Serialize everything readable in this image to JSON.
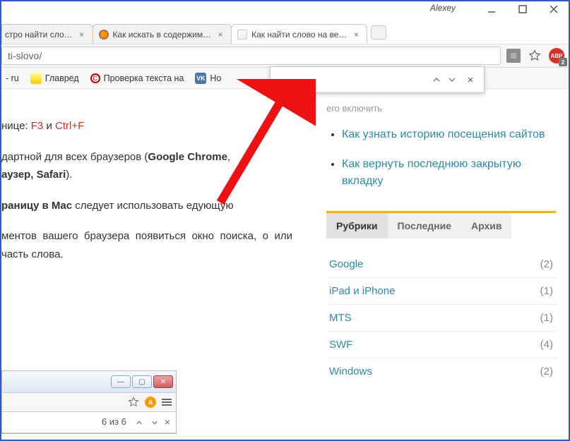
{
  "window": {
    "user_label": "Alexey"
  },
  "tabs": {
    "t0": {
      "title": "стро найти сло…"
    },
    "t1": {
      "title": "Как искать в содержим…"
    },
    "t2": {
      "title": "Как найти слово на ве…"
    }
  },
  "address": {
    "url_fragment": "ti-slovo/"
  },
  "abp": {
    "label": "ABP",
    "badge": "2"
  },
  "bookmarks": {
    "b0": "- ru",
    "b1": "Главред",
    "b2": "Проверка текста на",
    "b3": "Но"
  },
  "article": {
    "line1_a": "нице: ",
    "line1_b": "F3",
    "line1_c": " и ",
    "line1_d": "Ctrl+F",
    "p2_a": "дартной для всех браузеров (",
    "p2_b": "Google Chrome",
    "p2_c": "аузер, Safari",
    "p2_d": ").",
    "p3_a": "раницу в Mac",
    "p3_b": " следует использовать    едующую",
    "p4": "ментов вашего браузера появиться окно поиска, о или часть слова."
  },
  "sidebar_links": {
    "l0_a": "его включить",
    "l1": "Как узнать историю посещения сайтов",
    "l2": "Как вернуть последнюю закрытую вкладку"
  },
  "widget_tabs": {
    "t0": "Рубрики",
    "t1": "Последние",
    "t2": "Архив"
  },
  "categories": {
    "c0": {
      "name": "Google",
      "count": "(2)"
    },
    "c1": {
      "name": "iPad и iPhone",
      "count": "(1)"
    },
    "c2": {
      "name": "MTS",
      "count": "(1)"
    },
    "c3": {
      "name": "SWF",
      "count": "(4)"
    },
    "c4": {
      "name": "Windows",
      "count": "(2)"
    }
  },
  "inner": {
    "find_count": "6 из 6"
  }
}
